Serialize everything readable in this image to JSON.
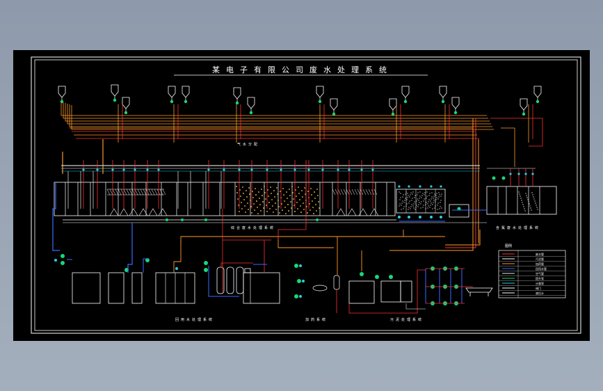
{
  "drawing": {
    "title": "某电子有限公司废水处理系统",
    "sections": [
      {
        "id": "main-process",
        "label": "综合废水处理系统"
      },
      {
        "id": "sub-process",
        "label": "含氟废水处理系统"
      },
      {
        "id": "mid-label",
        "label": "气水分配"
      },
      {
        "id": "dosing",
        "label": "加药系统"
      },
      {
        "id": "sludge",
        "label": "污泥处理系统"
      },
      {
        "id": "recycle",
        "label": "回用水处理系统"
      }
    ],
    "legend": {
      "title": "图例",
      "rows": [
        {
          "name": "废水管",
          "color": "#ff3030"
        },
        {
          "name": "污泥管",
          "color": "#ffffff"
        },
        {
          "name": "加药管",
          "color": "#ff9a2a"
        },
        {
          "name": "回用水管",
          "color": "#3b6bff"
        },
        {
          "name": "空气管",
          "color": "#e8e8e8"
        },
        {
          "name": "提升泵",
          "color": "#14d97a"
        },
        {
          "name": "计量泵",
          "color": "#22d1e8"
        },
        {
          "name": "阀门",
          "color": "#ffffff"
        },
        {
          "name": "液位计",
          "color": "#ffffff"
        }
      ]
    },
    "colors": {
      "background": "#000000",
      "frame": "#ffffff",
      "waste_pipe": "#ff3030",
      "chem_pipe": "#ff9a2a",
      "reuse_pipe": "#3b6bff",
      "air_pipe": "#cfcfcf",
      "pump": "#14d97a",
      "meter": "#22d1e8",
      "media": "#ffc44a"
    }
  }
}
